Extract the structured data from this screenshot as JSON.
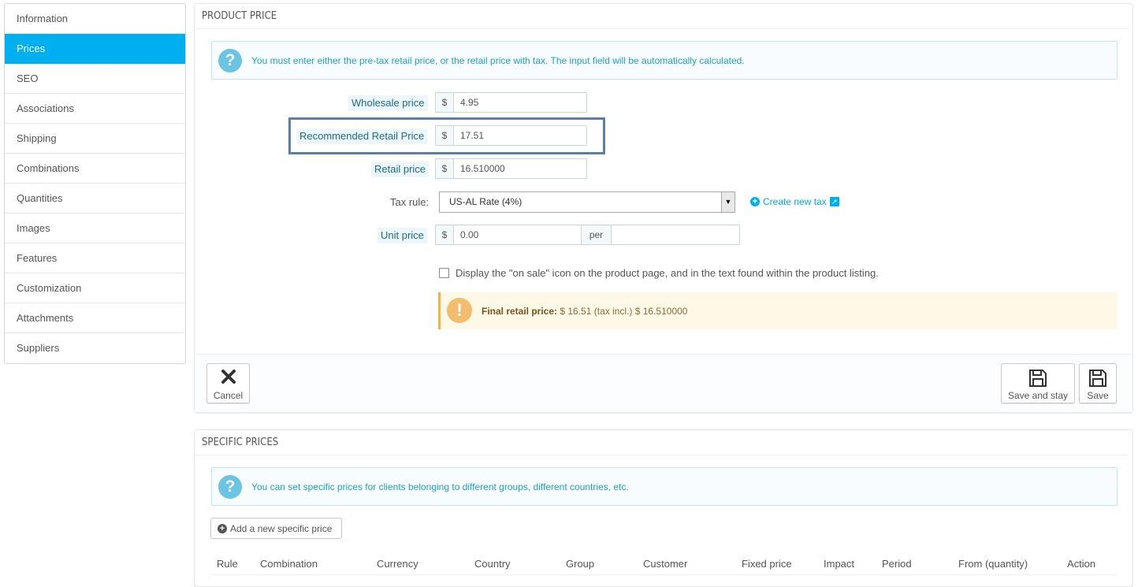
{
  "sidebar": {
    "items": [
      {
        "label": "Information"
      },
      {
        "label": "Prices",
        "active": true
      },
      {
        "label": "SEO"
      },
      {
        "label": "Associations"
      },
      {
        "label": "Shipping"
      },
      {
        "label": "Combinations"
      },
      {
        "label": "Quantities"
      },
      {
        "label": "Images"
      },
      {
        "label": "Features"
      },
      {
        "label": "Customization"
      },
      {
        "label": "Attachments"
      },
      {
        "label": "Suppliers"
      }
    ]
  },
  "product_price": {
    "heading": "PRODUCT PRICE",
    "info_text": "You must enter either the pre-tax retail price, or the retail price with tax. The input field will be automatically calculated.",
    "wholesale": {
      "label": "Wholesale price",
      "currency": "$",
      "value": "4.95"
    },
    "recommended": {
      "label": "Recommended Retail Price",
      "currency": "$",
      "value": "17.51"
    },
    "retail": {
      "label": "Retail price",
      "currency": "$",
      "value": "16.510000"
    },
    "tax_rule": {
      "label": "Tax rule:",
      "selected": "US-AL Rate (4%)",
      "create_link": "Create new tax"
    },
    "unit_price": {
      "label": "Unit price",
      "currency": "$",
      "value": "0.00",
      "per_label": "per",
      "per_value": ""
    },
    "on_sale_text": "Display the \"on sale\" icon on the product page, and in the text found within the product listing.",
    "final_price": {
      "label": "Final retail price:",
      "text": " $ 16.51 (tax incl.) $ 16.510000"
    },
    "cancel_label": "Cancel",
    "save_stay_label": "Save and stay",
    "save_label": "Save"
  },
  "specific_prices": {
    "heading": "SPECIFIC PRICES",
    "info_text": "You can set specific prices for clients belonging to different groups, different countries, etc.",
    "add_label": "Add a new specific price",
    "columns": [
      "Rule",
      "Combination",
      "Currency",
      "Country",
      "Group",
      "Customer",
      "Fixed price",
      "Impact",
      "Period",
      "From (quantity)",
      "Action"
    ]
  },
  "colors": {
    "accent": "#00aff0",
    "highlight_border": "#5b7fa6",
    "warning_bg": "#fef8e6"
  }
}
